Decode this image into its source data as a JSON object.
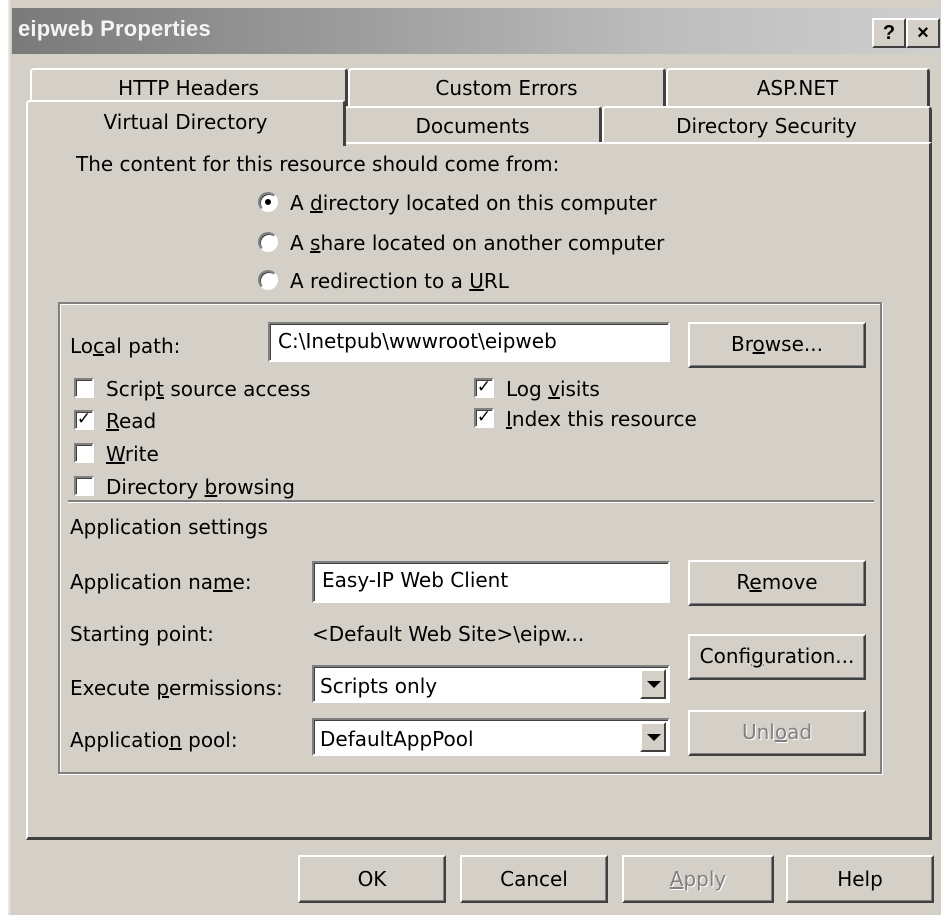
{
  "window": {
    "title": "eipweb Properties",
    "help_button": "?",
    "close_button": "×"
  },
  "tabs": {
    "row1": [
      "HTTP Headers",
      "Custom Errors",
      "ASP.NET"
    ],
    "row2": [
      "Virtual Directory",
      "Documents",
      "Directory Security"
    ],
    "active": "Virtual Directory"
  },
  "content_source": {
    "label": "The content for this resource should come from:",
    "options": [
      {
        "pre": "A ",
        "key": "d",
        "post": "irectory located on this computer",
        "selected": true
      },
      {
        "pre": "A ",
        "key": "s",
        "post": "hare located on another computer",
        "selected": false
      },
      {
        "pre": "A redirection to a ",
        "key": "U",
        "post": "RL",
        "selected": false
      }
    ]
  },
  "local_path": {
    "label_pre": "Lo",
    "label_key": "c",
    "label_post": "al path:",
    "value": "C:\\Inetpub\\wwwroot\\eipweb",
    "browse_pre": "Br",
    "browse_key": "o",
    "browse_post": "wse..."
  },
  "permissions": {
    "script_source_access": {
      "pre": "Scrip",
      "key": "t",
      "post": " source access",
      "checked": false
    },
    "read": {
      "pre": "",
      "key": "R",
      "post": "ead",
      "checked": true
    },
    "write": {
      "pre": "",
      "key": "W",
      "post": "rite",
      "checked": false
    },
    "directory_browsing": {
      "pre": "Directory ",
      "key": "b",
      "post": "rowsing",
      "checked": false
    },
    "log_visits": {
      "pre": "Log ",
      "key": "v",
      "post": "isits",
      "checked": true
    },
    "index_resource": {
      "pre": "",
      "key": "I",
      "post": "ndex this resource",
      "checked": true
    }
  },
  "app_settings": {
    "heading": "Application settings",
    "name_label_pre": "Application na",
    "name_label_key": "m",
    "name_label_post": "e:",
    "name_value": "Easy-IP Web Client",
    "remove_pre": "R",
    "remove_key": "e",
    "remove_post": "move",
    "starting_point_label": "Starting point:",
    "starting_point_value": "<Default Web Site>\\eipw...",
    "configuration_pre": "Confi",
    "configuration_key": "g",
    "configuration_post": "uration...",
    "execute_label_pre": "Execute ",
    "execute_label_key": "p",
    "execute_label_post": "ermissions:",
    "execute_value": "Scripts only",
    "pool_label_pre": "Applicatio",
    "pool_label_key": "n",
    "pool_label_post": " pool:",
    "pool_value": "DefaultAppPool",
    "unload_pre": "Unl",
    "unload_key": "o",
    "unload_post": "ad"
  },
  "footer": {
    "ok": "OK",
    "cancel": "Cancel",
    "apply_key": "A",
    "apply_post": "pply",
    "help": "Help"
  }
}
